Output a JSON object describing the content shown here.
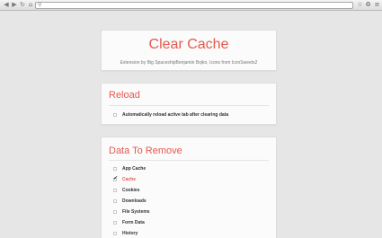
{
  "browser": {
    "back_icon": "back-arrow-icon",
    "forward_icon": "forward-arrow-icon",
    "reload_icon": "reload-icon",
    "home_icon": "home-icon",
    "omnibox_value": ""
  },
  "header": {
    "title": "Clear Cache",
    "credit": "Extension by Big SpaceshipBenjamin Bojko, Icons from IconSweets2"
  },
  "reload": {
    "heading": "Reload",
    "option": {
      "label": "Automatically reload active tab after clearing data",
      "checked": false
    }
  },
  "data_to_remove": {
    "heading": "Data To Remove",
    "options": [
      {
        "label": "App Cache",
        "checked": false
      },
      {
        "label": "Cache",
        "checked": true
      },
      {
        "label": "Cookies",
        "checked": false
      },
      {
        "label": "Downloads",
        "checked": false
      },
      {
        "label": "File Systems",
        "checked": false
      },
      {
        "label": "Form Data",
        "checked": false
      },
      {
        "label": "History",
        "checked": false
      }
    ]
  },
  "colors": {
    "accent": "#e35a4f",
    "background": "#e6e6e6",
    "card": "#fbfbfb"
  }
}
